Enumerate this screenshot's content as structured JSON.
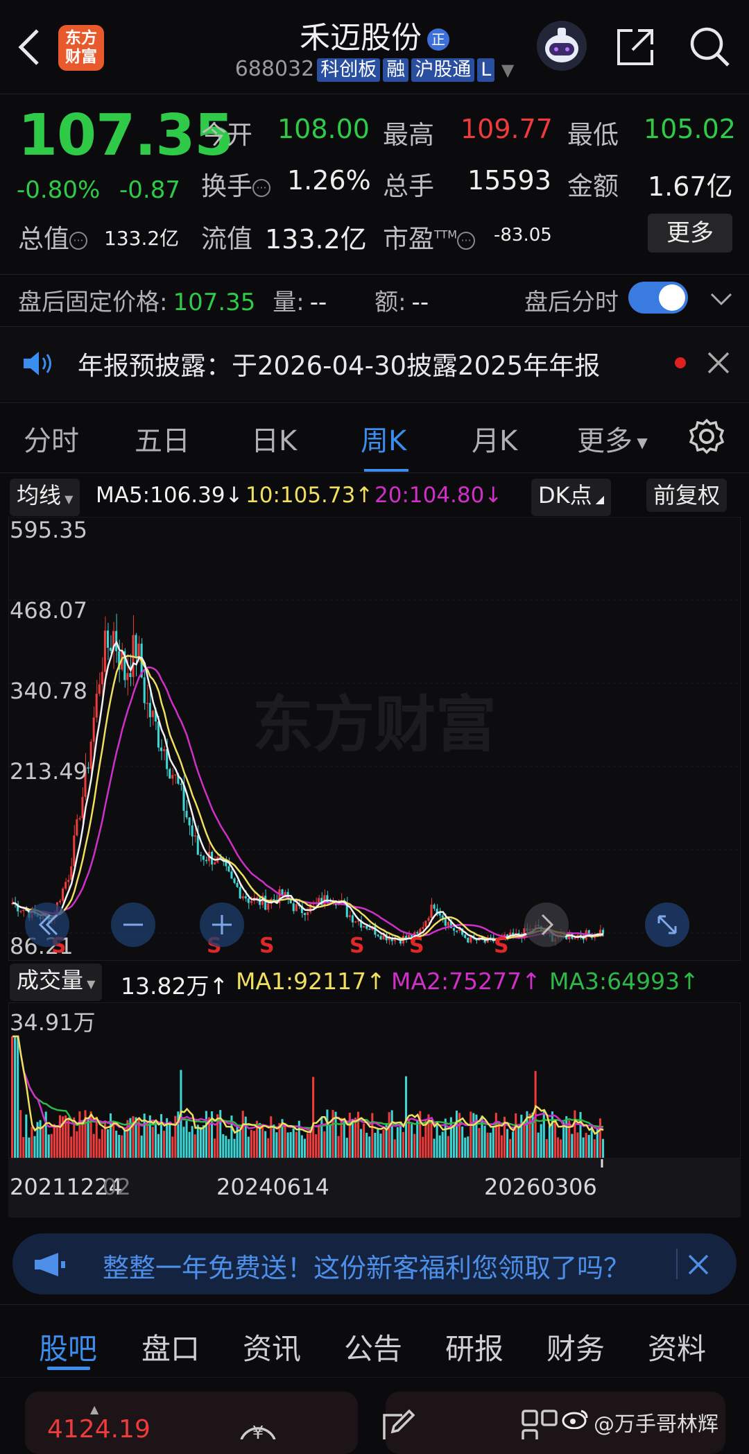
{
  "header": {
    "logo_line1": "东方",
    "logo_line2": "财富",
    "stock_name": "禾迈股份",
    "badge": "正",
    "code": "688032",
    "tags": [
      "科创板",
      "融",
      "沪股通",
      "L"
    ]
  },
  "quote": {
    "price": "107.35",
    "change_pct": "-0.80%",
    "change_amt": "-0.87",
    "open_label": "今开",
    "open": "108.00",
    "high_label": "最高",
    "high": "109.77",
    "low_label": "最低",
    "low": "105.02",
    "turnover_label": "换手",
    "turnover": "1.26%",
    "volume_label": "总手",
    "volume": "15593",
    "amount_label": "金额",
    "amount": "1.67亿",
    "mktcap_label": "总值",
    "mktcap": "133.2亿",
    "float_label": "流值",
    "float_cap": "133.2亿",
    "pe_label": "市盈",
    "pe_sup": "TTM",
    "pe": "-83.05",
    "more_button": "更多"
  },
  "after_hours": {
    "label": "盘后固定价格:",
    "price": "107.35",
    "vol_label": "量:",
    "vol": "--",
    "amt_label": "额:",
    "amt": "--",
    "timeshare_label": "盘后分时",
    "toggle_on": true
  },
  "notice": {
    "text": "年报预披露：于2026-04-30披露2025年年报"
  },
  "tabs": [
    "分时",
    "五日",
    "日K",
    "周K",
    "月K",
    "更多"
  ],
  "active_tab": "周K",
  "chart_bar": {
    "ma_select": "均线",
    "ma5": "MA5:106.39↓",
    "ma10": "10:105.73↑",
    "ma20": "20:104.80↓",
    "dk_button": "DK点",
    "adjust_button": "前复权"
  },
  "chart_data": {
    "type": "candlestick",
    "y_ticks": [
      "595.35",
      "468.07",
      "340.78",
      "213.49",
      "86.21"
    ],
    "ylim": [
      86.21,
      595.35
    ],
    "watermark": "东方财富",
    "markers": [
      "S",
      "S",
      "S",
      "S",
      "S",
      "S"
    ],
    "volume": {
      "label": "成交量",
      "value": "13.82万↑",
      "ma1": "MA1:92117↑",
      "ma2": "MA2:75277↑",
      "ma3": "MA3:64993↑",
      "y_tick": "34.91万"
    },
    "x_ticks": [
      "20211224",
      "02",
      "20240614",
      "20260306"
    ],
    "colors": {
      "up": "#ee3b3b",
      "down": "#3ed5d5",
      "ma5": "#f2f2f2",
      "ma10": "#f0e060",
      "ma20": "#d030c8",
      "vol_ma3": "#2fb84a"
    }
  },
  "promo": {
    "text": "整整一年免费送！这份新客福利您领取了吗？"
  },
  "bottom_tabs": [
    "股吧",
    "盘口",
    "资讯",
    "公告",
    "研报",
    "财务",
    "资料"
  ],
  "active_bottom_tab": "股吧",
  "bottom_bar": {
    "index_value": "4124.19",
    "watermark": "@万手哥林辉"
  }
}
